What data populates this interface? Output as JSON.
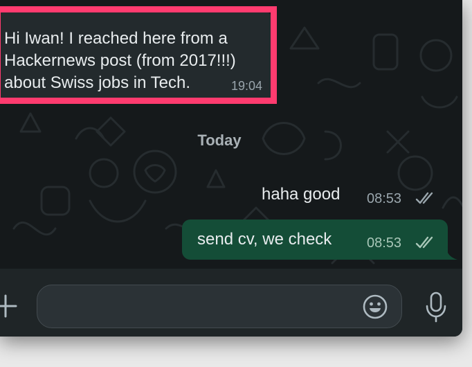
{
  "chat": {
    "incoming": {
      "text": "Hi Iwan! I reached here from a\nHackernews post (from 2017!!!)\nabout Swiss jobs in Tech.",
      "time": "19:04"
    },
    "date_separator": "Today",
    "outgoing": [
      {
        "text": "haha good",
        "time": "08:53",
        "status_icon": "double-check-icon"
      },
      {
        "text": "send cv, we check",
        "time": "08:53",
        "status_icon": "double-check-icon"
      }
    ]
  },
  "composer": {
    "input_value": "",
    "input_placeholder": "",
    "attach_icon": "plus-icon",
    "emoji_icon": "smiley-icon",
    "voice_icon": "microphone-icon"
  },
  "colors": {
    "chat_background": "#15191b",
    "incoming_bubble": "#232a2d",
    "outgoing_bubble": "#144d37",
    "highlight": "#ff3b6f",
    "composer_background": "#1f2527"
  }
}
